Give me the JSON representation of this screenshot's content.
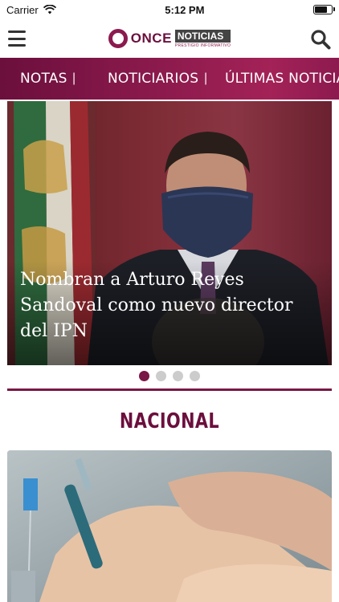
{
  "status_bar": {
    "carrier": "Carrier",
    "time": "5:12 PM"
  },
  "header": {
    "logo_once": "ONCE",
    "logo_noticias": "NOTICIAS",
    "logo_tagline": "PRESTIGIO INFORMATIVO"
  },
  "nav": {
    "items": [
      {
        "label": "NOTAS"
      },
      {
        "label": "NOTICIARIOS"
      },
      {
        "label": "ÚLTIMAS NOTICIAS"
      }
    ],
    "separator": "|"
  },
  "hero": {
    "caption": "Nombran a Arturo Reyes Sandoval como nuevo director del IPN"
  },
  "carousel": {
    "page_count": 4,
    "active_index": 0
  },
  "section": {
    "title": "NACIONAL"
  },
  "colors": {
    "brand": "#7a1745",
    "brand_dark": "#6b0f3d",
    "accent": "#a32257"
  },
  "icons": {
    "menu": "hamburger-icon",
    "search": "search-icon",
    "wifi": "wifi-icon",
    "battery": "battery-icon"
  }
}
